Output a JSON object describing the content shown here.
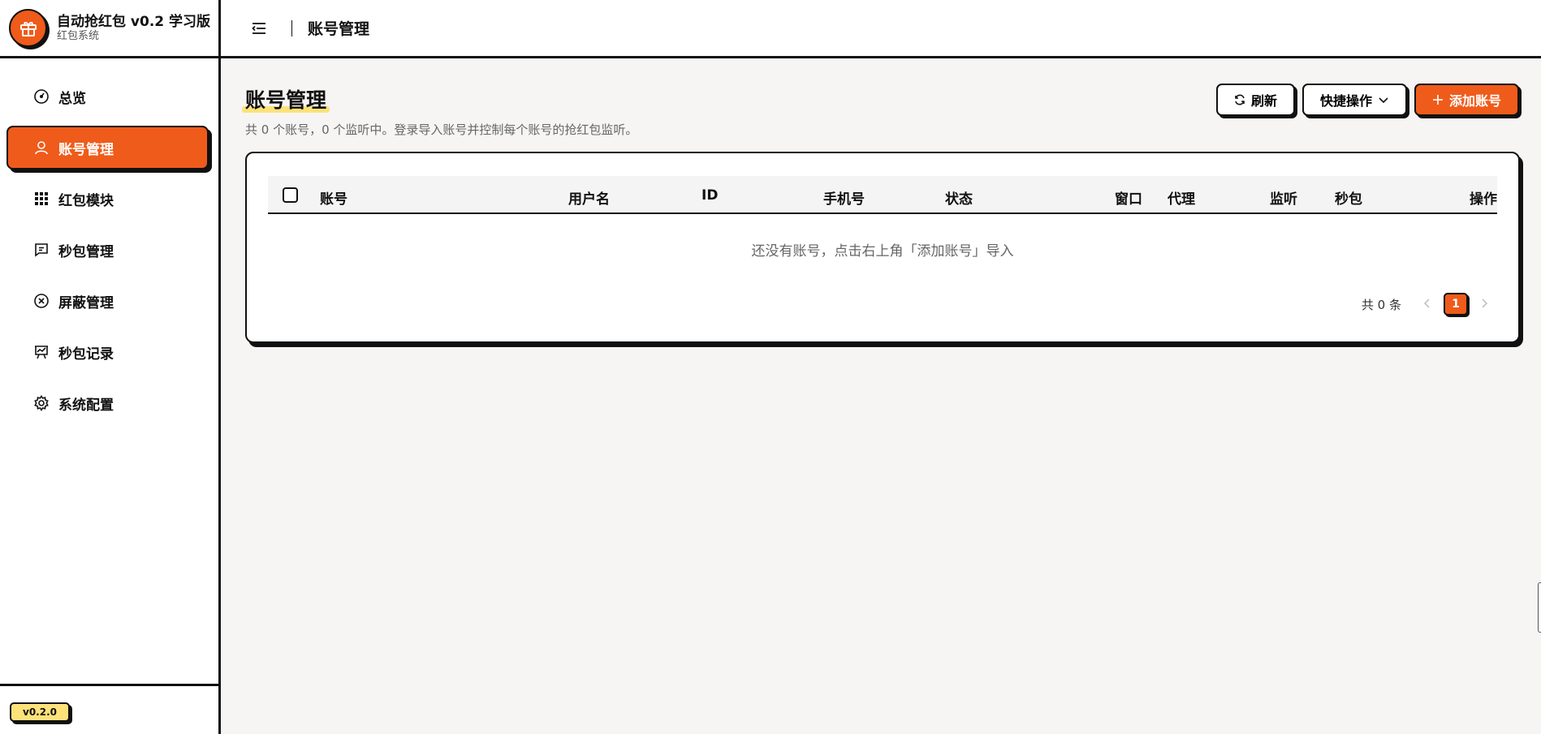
{
  "brand": {
    "title": "自动抢红包 v0.2 学习版",
    "subtitle": "红包系统",
    "logo_icon": "gift-icon"
  },
  "sidebar": {
    "items": [
      {
        "label": "总览",
        "icon": "gauge-icon",
        "active": false
      },
      {
        "label": "账号管理",
        "icon": "user-icon",
        "active": true
      },
      {
        "label": "红包模块",
        "icon": "grid-icon",
        "active": false
      },
      {
        "label": "秒包管理",
        "icon": "message-icon",
        "active": false
      },
      {
        "label": "屏蔽管理",
        "icon": "block-icon",
        "active": false
      },
      {
        "label": "秒包记录",
        "icon": "presentation-icon",
        "active": false
      },
      {
        "label": "系统配置",
        "icon": "gear-icon",
        "active": false
      }
    ],
    "version": "v0.2.0"
  },
  "topbar": {
    "title": "账号管理"
  },
  "page": {
    "title": "账号管理",
    "description": "共 0 个账号，0 个监听中。登录导入账号并控制每个账号的抢红包监听。",
    "actions": {
      "refresh": "刷新",
      "quick": "快捷操作",
      "add": "添加账号"
    }
  },
  "table": {
    "columns": [
      "账号",
      "用户名",
      "ID",
      "手机号",
      "状态",
      "窗口",
      "代理",
      "监听",
      "秒包",
      "操作"
    ],
    "empty_text": "还没有账号，点击右上角「添加账号」导入"
  },
  "pagination": {
    "total_text": "共 0 条",
    "current_page": "1"
  },
  "colors": {
    "accent": "#ef5b1a",
    "highlight": "#fde27a",
    "border": "#111111",
    "background": "#f6f5f4"
  }
}
